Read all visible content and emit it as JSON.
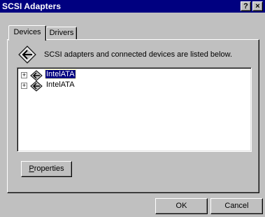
{
  "window": {
    "title": "SCSI Adapters",
    "help_label": "?",
    "close_label": "×"
  },
  "tabs": [
    {
      "label": "Devices",
      "active": true
    },
    {
      "label": "Drivers",
      "active": false
    }
  ],
  "devices_tab": {
    "description": "SCSI adapters and connected devices are listed below.",
    "header_icon": "scsi-adapter-icon",
    "tree": [
      {
        "label": "IntelATA",
        "selected": true,
        "expander": "+",
        "icon": "scsi-adapter-icon"
      },
      {
        "label": "IntelATA",
        "selected": false,
        "expander": "+",
        "icon": "scsi-adapter-icon"
      }
    ],
    "properties_mnemonic": "P",
    "properties_rest": "roperties"
  },
  "buttons": {
    "ok": "OK",
    "cancel": "Cancel"
  },
  "colors": {
    "titlebar": "#000080",
    "face": "#c0c0c0",
    "selection": "#000080"
  }
}
